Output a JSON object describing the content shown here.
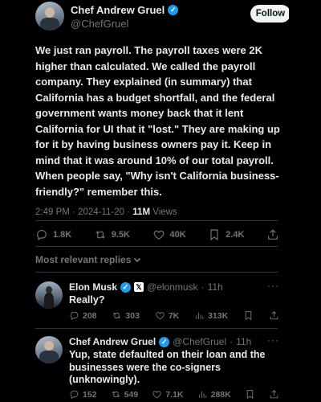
{
  "post": {
    "author_name": "Chef Andrew Gruel",
    "author_handle": "@ChefGruel",
    "follow_label": "Follow",
    "text": "We just ran payroll. The payroll taxes were 2K higher than calculated. We called the payroll company. They explained (in summary) that California has a budget shortfall, and the federal government wants money back that it lent California for UI that it \"lost.\" They are making up for it by having business owners pay it. Keep in mind that it was around 10% of our total payroll. When people say, \"Why isn't California business-friendly?\" remember this.",
    "time": "2:49 PM",
    "date": "2024-11-20",
    "views_count": "11M",
    "views_label": "Views",
    "stats": {
      "replies": "1.8K",
      "reposts": "9.5K",
      "likes": "40K",
      "bookmarks": "2.4K"
    },
    "sort_label": "Most relevant replies"
  },
  "replies": [
    {
      "name": "Elon Musk",
      "handle": "@elonmusk",
      "age": "11h",
      "text": "Really?",
      "more": "···",
      "stats": {
        "replies": "208",
        "reposts": "303",
        "likes": "7K",
        "views": "313K"
      }
    },
    {
      "name": "Chef Andrew Gruel",
      "handle": "@ChefGruel",
      "age": "11h",
      "text": "Yup, state defaulted on their loan and the businesses were the co-signers (unknowingly).",
      "more": "···",
      "stats": {
        "replies": "152",
        "reposts": "549",
        "likes": "7.1K",
        "views": "288K"
      }
    }
  ],
  "icons": {
    "verified": "verified-badge-icon",
    "affiliate": "x-affiliate-badge-icon",
    "reply": "reply-icon",
    "repost": "repost-icon",
    "like": "heart-icon",
    "bookmark": "bookmark-icon",
    "share": "share-icon",
    "views": "views-bars-icon",
    "chevron": "chevron-down-icon"
  },
  "colors": {
    "background": "#000000",
    "text": "#e7e9ea",
    "secondary": "#71767b",
    "verified": "#1d9bf0",
    "divider": "#2f3336"
  }
}
